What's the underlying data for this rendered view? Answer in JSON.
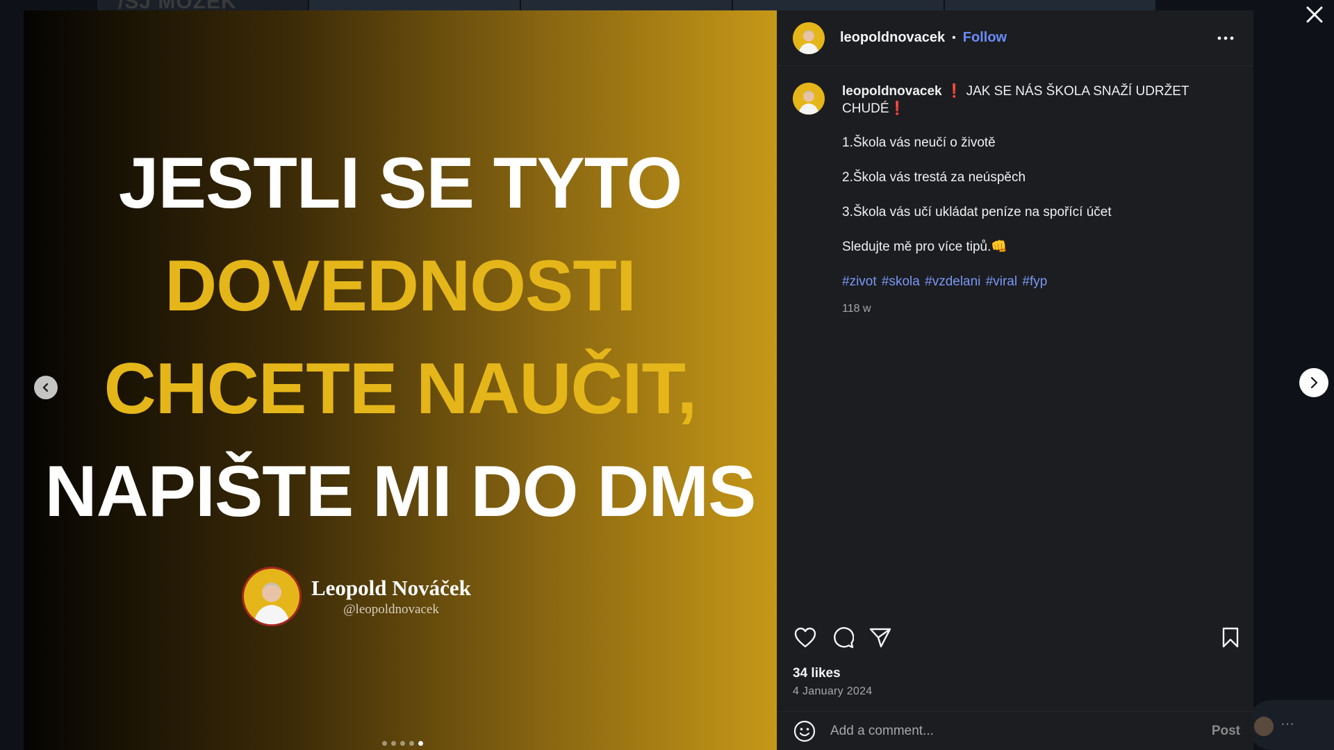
{
  "background": {
    "feed_text": "/SJ MOZEK"
  },
  "media": {
    "lines": [
      {
        "text": "JESTLI SE TYTO",
        "color": "white"
      },
      {
        "text": "DOVEDNOSTI",
        "color": "yellow"
      },
      {
        "text": "CHCETE NAUČIT,",
        "color": "yellow"
      },
      {
        "text": "NAPIŠTE MI DO DMS",
        "color": "white"
      }
    ],
    "author_name": "Leopold Nováček",
    "author_handle": "@leopoldnovacek",
    "carousel": {
      "count": 5,
      "active_index": 4
    }
  },
  "header": {
    "username": "leopoldnovacek",
    "separator": "•",
    "follow_label": "Follow"
  },
  "caption": {
    "username": "leopoldnovacek",
    "title": "JAK SE NÁS ŠKOLA SNAŽÍ UDRŽET CHUDÉ",
    "exclamation": "❗",
    "points": [
      "1.Škola vás neučí o životě",
      "2.Škola vás trestá za neúspěch",
      "3.Škola vás učí ukládat peníze na spořící účet",
      "Sledujte mě pro více tipů.👊"
    ],
    "hashtags": [
      "#zivot",
      "#skola",
      "#vzdelani",
      "#viral",
      "#fyp"
    ],
    "time_ago": "118 w"
  },
  "stats": {
    "likes": "34 likes",
    "date": "4 January 2024"
  },
  "comment": {
    "placeholder": "Add a comment...",
    "post_label": "Post"
  },
  "colors": {
    "accent": "#6b8cf7",
    "brand_yellow": "#e5b619",
    "exclamation_red": "#e0182d"
  },
  "icons": {
    "close": "close-icon",
    "more": "more-options-icon",
    "like": "heart-icon",
    "comment": "comment-icon",
    "share": "send-icon",
    "save": "bookmark-icon",
    "emoji": "emoji-icon",
    "prev": "chevron-left-icon",
    "next": "chevron-right-icon"
  }
}
